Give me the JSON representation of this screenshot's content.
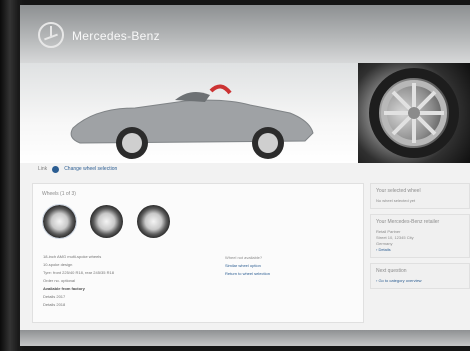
{
  "header": {
    "brand": "Mercedes-Benz"
  },
  "hero": {
    "alt": "SLK roadster side view"
  },
  "changer": {
    "prefix": "Link",
    "label": "Change wheel selection"
  },
  "wheels_panel": {
    "title": "Wheels (1 of 3)",
    "spec": [
      "18-inch AMG multi-spoke wheels",
      "10-spoke design",
      "Tyre: front 225/40 R18, rear 245/35 R18",
      "Order no. optional",
      "Available from factory",
      "Details 2017",
      "Details 2018"
    ],
    "aside_title": "Wheel not available?",
    "aside_lines": [
      "Similar wheel option",
      "Return to wheel selection"
    ]
  },
  "right": {
    "box1_title": "Your selected wheel",
    "box1_lines": [
      "No wheel selected yet"
    ],
    "box2_title": "Your Mercedes-Benz retailer",
    "box2_lines": [
      "Retail Partner",
      "Street 10, 12345 City",
      "Germany",
      "› Details"
    ],
    "box3_title": "Next question",
    "box3_lines": [
      "› Go to category overview"
    ]
  },
  "colors": {
    "accent": "#2b5d92",
    "panel_bg": "#fbfbfb"
  }
}
